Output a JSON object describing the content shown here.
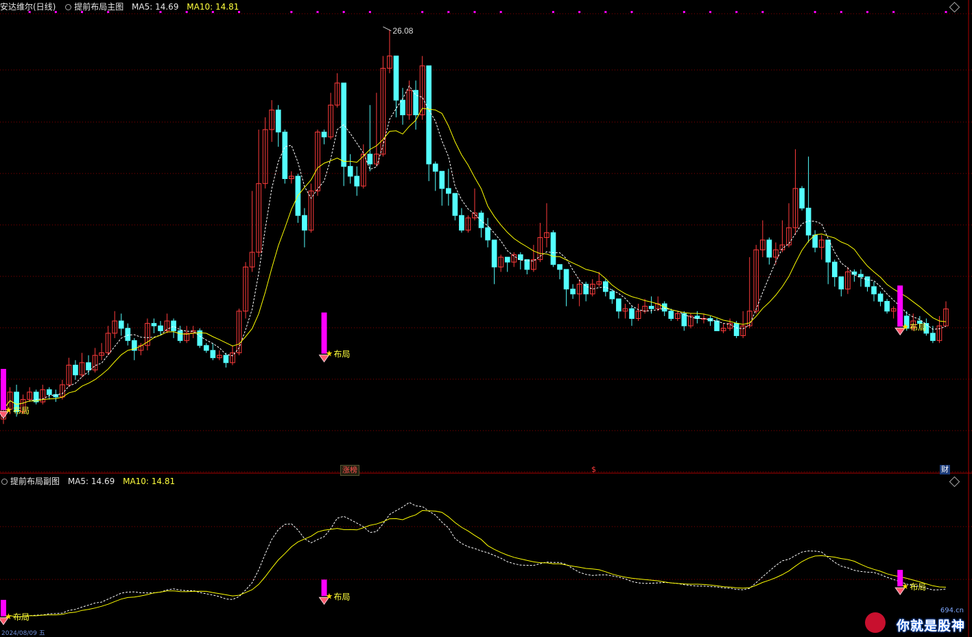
{
  "window": {
    "stock_name": "安达维尔(日线)",
    "main_indicator": "提前布局主图",
    "sub_indicator": "提前布局副图",
    "ma5_label": "MA5: 14.69",
    "ma10_label": "MA10: 14.81"
  },
  "annotations": {
    "peak_label": "26.08",
    "signal_label": "布局",
    "flag_zhangting": "涨榜",
    "flag_dollar": "$",
    "flag_cai": "财",
    "date_fragment": "2024/08/09 五"
  },
  "watermark": {
    "main": "你就是股神",
    "site": "694.cn"
  },
  "colors": {
    "up": "#ff3c3c",
    "down": "#54ffff",
    "ma5": "#ffffff",
    "ma10": "#ffff00",
    "signal": "#ff00ff",
    "grid": "#8b0000"
  },
  "chart_data": {
    "type": "candlestick",
    "series": [
      {
        "name": "MA5",
        "style": "dashed-white"
      },
      {
        "name": "MA10",
        "style": "solid-yellow"
      }
    ],
    "ylim": [
      8.5,
      26.5
    ],
    "candles": [
      [
        10.2,
        10.6,
        10.8,
        10.0
      ],
      [
        10.6,
        11.3,
        11.5,
        10.4
      ],
      [
        11.3,
        10.5,
        11.6,
        10.3
      ],
      [
        10.5,
        11.0,
        11.2,
        10.4
      ],
      [
        11.0,
        11.3,
        11.5,
        10.9
      ],
      [
        11.3,
        10.9,
        11.4,
        10.8
      ],
      [
        10.9,
        11.4,
        11.6,
        10.8
      ],
      [
        11.4,
        11.2,
        11.5,
        11.0
      ],
      [
        11.2,
        11.1,
        11.4,
        10.9
      ],
      [
        11.1,
        11.6,
        11.8,
        11.0
      ],
      [
        11.6,
        12.4,
        12.7,
        11.5
      ],
      [
        12.4,
        12.0,
        12.6,
        11.8
      ],
      [
        12.0,
        12.5,
        12.9,
        11.9
      ],
      [
        12.5,
        12.2,
        12.8,
        12.0
      ],
      [
        12.2,
        12.8,
        13.1,
        12.1
      ],
      [
        12.8,
        12.9,
        13.3,
        12.6
      ],
      [
        12.9,
        13.7,
        14.0,
        12.8
      ],
      [
        13.7,
        14.2,
        14.6,
        13.5
      ],
      [
        14.2,
        13.9,
        14.5,
        13.6
      ],
      [
        13.9,
        13.4,
        14.1,
        13.2
      ],
      [
        13.4,
        13.0,
        13.5,
        12.6
      ],
      [
        13.0,
        13.2,
        13.3,
        12.8
      ],
      [
        13.2,
        14.1,
        14.3,
        13.0
      ],
      [
        14.1,
        14.0,
        14.3,
        13.7
      ],
      [
        14.0,
        13.8,
        14.2,
        13.6
      ],
      [
        13.8,
        14.2,
        14.5,
        13.7
      ],
      [
        14.2,
        13.8,
        14.3,
        13.5
      ],
      [
        13.8,
        13.4,
        14.0,
        13.3
      ],
      [
        13.4,
        13.7,
        14.0,
        13.3
      ],
      [
        13.7,
        13.8,
        14.0,
        13.5
      ],
      [
        13.8,
        13.2,
        13.9,
        13.1
      ],
      [
        13.2,
        13.0,
        13.3,
        12.9
      ],
      [
        13.0,
        12.7,
        13.3,
        12.6
      ],
      [
        12.7,
        12.8,
        13.0,
        12.6
      ],
      [
        12.8,
        12.5,
        12.9,
        12.3
      ],
      [
        12.5,
        12.9,
        13.2,
        12.4
      ],
      [
        12.9,
        14.6,
        14.7,
        12.8
      ],
      [
        14.6,
        16.4,
        16.6,
        14.3
      ],
      [
        16.4,
        17.0,
        19.5,
        16.2
      ],
      [
        17.0,
        19.8,
        22.0,
        16.8
      ],
      [
        19.8,
        22.0,
        22.5,
        19.6
      ],
      [
        22.0,
        22.8,
        23.2,
        21.5
      ],
      [
        22.8,
        21.9,
        23.0,
        21.3
      ],
      [
        21.9,
        20.0,
        22.0,
        19.8
      ],
      [
        20.0,
        20.1,
        20.3,
        19.8
      ],
      [
        20.1,
        18.5,
        20.2,
        18.2
      ],
      [
        18.5,
        17.9,
        18.8,
        17.2
      ],
      [
        17.9,
        19.5,
        19.8,
        17.8
      ],
      [
        19.5,
        21.9,
        22.0,
        19.3
      ],
      [
        21.9,
        21.7,
        22.0,
        21.4
      ],
      [
        21.7,
        23.0,
        23.5,
        21.6
      ],
      [
        23.0,
        23.9,
        24.3,
        22.9
      ],
      [
        23.9,
        20.5,
        21.0,
        19.7
      ],
      [
        20.5,
        20.1,
        21.0,
        19.8
      ],
      [
        20.1,
        19.7,
        20.5,
        19.3
      ],
      [
        19.7,
        21.0,
        21.4,
        19.6
      ],
      [
        21.0,
        20.6,
        23.0,
        20.3
      ],
      [
        20.6,
        21.0,
        23.5,
        20.5
      ],
      [
        21.0,
        24.5,
        25.0,
        20.9
      ],
      [
        24.5,
        25.0,
        26.08,
        24.3
      ],
      [
        25.0,
        23.2,
        23.3,
        22.5
      ],
      [
        23.2,
        22.6,
        23.7,
        22.2
      ],
      [
        22.6,
        23.6,
        24.0,
        22.4
      ],
      [
        23.6,
        22.6,
        24.0,
        22.0
      ],
      [
        22.6,
        24.6,
        25.0,
        22.4
      ],
      [
        24.6,
        20.6,
        21.6,
        19.9
      ],
      [
        20.6,
        20.3,
        20.7,
        19.5
      ],
      [
        20.3,
        19.6,
        19.8,
        18.9
      ],
      [
        19.6,
        19.4,
        20.4,
        18.9
      ],
      [
        19.4,
        18.5,
        19.4,
        18.3
      ],
      [
        18.5,
        17.9,
        18.8,
        17.8
      ],
      [
        17.9,
        18.4,
        18.5,
        17.8
      ],
      [
        18.4,
        18.6,
        19.6,
        18.3
      ],
      [
        18.6,
        18.0,
        18.7,
        17.6
      ],
      [
        18.0,
        17.5,
        18.4,
        17.2
      ],
      [
        17.5,
        16.4,
        16.7,
        15.7
      ],
      [
        16.4,
        16.8,
        16.9,
        16.2
      ],
      [
        16.8,
        16.6,
        16.8,
        16.2
      ],
      [
        16.6,
        16.9,
        17.0,
        16.4
      ],
      [
        16.9,
        16.7,
        17.0,
        16.3
      ],
      [
        16.7,
        16.3,
        16.7,
        16.1
      ],
      [
        16.3,
        16.7,
        17.3,
        16.2
      ],
      [
        16.7,
        17.6,
        18.2,
        16.6
      ],
      [
        17.6,
        17.8,
        19.0,
        17.2
      ],
      [
        17.8,
        16.5,
        17.9,
        16.4
      ],
      [
        16.5,
        16.3,
        16.5,
        15.9
      ],
      [
        16.3,
        15.5,
        15.6,
        14.8
      ],
      [
        15.5,
        15.3,
        15.7,
        15.1
      ],
      [
        15.3,
        15.7,
        15.9,
        14.8
      ],
      [
        15.7,
        15.3,
        15.8,
        15.0
      ],
      [
        15.3,
        15.7,
        15.9,
        15.2
      ],
      [
        15.7,
        15.8,
        16.2,
        15.6
      ],
      [
        15.8,
        15.4,
        15.9,
        15.2
      ],
      [
        15.4,
        15.1,
        15.5,
        14.9
      ],
      [
        15.1,
        14.6,
        15.1,
        14.3
      ],
      [
        14.6,
        14.7,
        14.9,
        14.3
      ],
      [
        14.7,
        14.3,
        14.8,
        14.0
      ],
      [
        14.3,
        14.6,
        14.9,
        14.2
      ],
      [
        14.6,
        14.8,
        15.1,
        14.5
      ],
      [
        14.8,
        14.7,
        15.2,
        14.5
      ],
      [
        14.7,
        14.9,
        15.2,
        14.6
      ],
      [
        14.9,
        14.6,
        15.0,
        14.4
      ],
      [
        14.6,
        14.3,
        14.7,
        14.2
      ],
      [
        14.3,
        14.5,
        14.6,
        14.2
      ],
      [
        14.5,
        14.0,
        14.6,
        13.8
      ],
      [
        14.0,
        14.4,
        14.5,
        13.9
      ],
      [
        14.4,
        14.3,
        14.6,
        14.1
      ],
      [
        14.3,
        14.3,
        14.5,
        14.1
      ],
      [
        14.3,
        14.2,
        14.4,
        14.0
      ],
      [
        14.2,
        13.8,
        14.3,
        13.8
      ],
      [
        13.8,
        13.9,
        14.1,
        13.7
      ],
      [
        13.9,
        14.1,
        14.3,
        13.8
      ],
      [
        14.1,
        13.6,
        14.2,
        13.5
      ],
      [
        13.6,
        14.0,
        14.6,
        13.5
      ],
      [
        14.0,
        14.6,
        16.8,
        13.9
      ],
      [
        14.6,
        17.1,
        17.3,
        14.5
      ],
      [
        17.1,
        17.5,
        18.3,
        16.8
      ],
      [
        17.5,
        16.8,
        17.6,
        16.5
      ],
      [
        16.8,
        17.1,
        17.4,
        16.5
      ],
      [
        17.1,
        17.3,
        18.3,
        17.0
      ],
      [
        17.3,
        18.0,
        19.0,
        17.2
      ],
      [
        18.0,
        19.6,
        21.2,
        17.7
      ],
      [
        19.6,
        18.8,
        19.7,
        18.7
      ],
      [
        18.8,
        17.7,
        20.9,
        17.4
      ],
      [
        17.7,
        17.2,
        17.9,
        17.0
      ],
      [
        17.2,
        17.5,
        17.7,
        16.7
      ],
      [
        17.5,
        16.6,
        16.8,
        15.7
      ],
      [
        16.6,
        16.0,
        16.7,
        15.6
      ],
      [
        16.0,
        15.5,
        15.9,
        15.2
      ],
      [
        15.5,
        16.2,
        16.4,
        15.3
      ],
      [
        16.2,
        16.1,
        16.3,
        15.8
      ],
      [
        16.1,
        16.0,
        16.3,
        15.6
      ],
      [
        16.0,
        15.6,
        15.9,
        15.4
      ],
      [
        15.6,
        15.3,
        15.8,
        15.0
      ],
      [
        15.3,
        15.0,
        15.4,
        14.8
      ],
      [
        15.0,
        14.6,
        15.1,
        14.5
      ],
      [
        14.6,
        14.7,
        14.8,
        14.3
      ],
      [
        14.7,
        14.4,
        14.8,
        14.2
      ],
      [
        14.4,
        13.9,
        14.6,
        13.8
      ],
      [
        13.9,
        14.2,
        14.5,
        13.8
      ],
      [
        14.2,
        14.1,
        14.4,
        13.9
      ],
      [
        14.1,
        13.7,
        14.3,
        13.6
      ],
      [
        13.7,
        13.4,
        14.0,
        13.3
      ],
      [
        13.4,
        14.0,
        14.4,
        13.3
      ],
      [
        14.0,
        14.69,
        15.0,
        14.0
      ]
    ],
    "signals": [
      {
        "index": 0,
        "value": 10.4
      },
      {
        "index": 49,
        "value": 12.7
      },
      {
        "index": 137,
        "value": 13.8
      }
    ],
    "peak": {
      "index": 58,
      "value": 26.08
    }
  }
}
